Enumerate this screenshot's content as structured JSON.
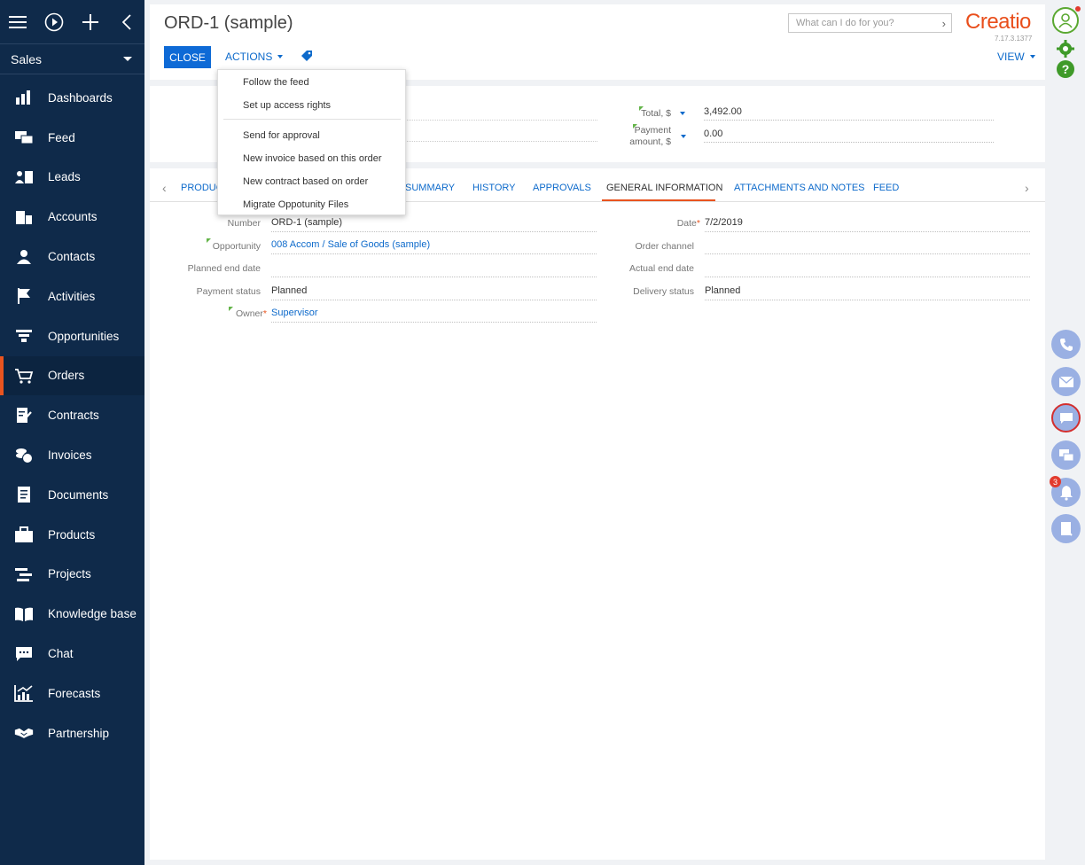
{
  "sidebar": {
    "workplace": "Sales",
    "items": [
      {
        "label": "Dashboards",
        "icon": "bar-chart-icon"
      },
      {
        "label": "Feed",
        "icon": "feed-icon"
      },
      {
        "label": "Leads",
        "icon": "leads-icon"
      },
      {
        "label": "Accounts",
        "icon": "accounts-icon"
      },
      {
        "label": "Contacts",
        "icon": "contact-icon"
      },
      {
        "label": "Activities",
        "icon": "flag-icon"
      },
      {
        "label": "Opportunities",
        "icon": "funnel-icon"
      },
      {
        "label": "Orders",
        "icon": "cart-icon"
      },
      {
        "label": "Contracts",
        "icon": "contract-icon"
      },
      {
        "label": "Invoices",
        "icon": "invoice-icon"
      },
      {
        "label": "Documents",
        "icon": "document-icon"
      },
      {
        "label": "Products",
        "icon": "products-icon"
      },
      {
        "label": "Projects",
        "icon": "projects-icon"
      },
      {
        "label": "Knowledge base",
        "icon": "book-icon"
      },
      {
        "label": "Chat",
        "icon": "chat-icon"
      },
      {
        "label": "Forecasts",
        "icon": "forecast-icon"
      },
      {
        "label": "Partnership",
        "icon": "handshake-icon"
      }
    ],
    "active": "Orders"
  },
  "header": {
    "title": "ORD-1 (sample)",
    "close_label": "CLOSE",
    "actions_label": "ACTIONS",
    "view_label": "VIEW",
    "search_placeholder": "What can I do for you?",
    "logo": "Creatio",
    "version": "7.17.3.1377"
  },
  "actions_menu": [
    "Follow the feed",
    "Set up access rights",
    "Send for approval",
    "New invoice based on this order",
    "New contract based on order",
    "Migrate Oppotunity Files"
  ],
  "summary": {
    "total_label": "Total, $",
    "total_value": "3,492.00",
    "payment_label_1": "Payment",
    "payment_label_2": "amount, $",
    "payment_value": "0.00"
  },
  "tabs": {
    "items": [
      "PRODUC",
      "SUMMARY",
      "HISTORY",
      "APPROVALS",
      "GENERAL INFORMATION",
      "ATTACHMENTS AND NOTES",
      "FEED"
    ],
    "active": "GENERAL INFORMATION"
  },
  "general": {
    "number_label": "Number",
    "number_value": "ORD-1 (sample)",
    "opportunity_label": "Opportunity",
    "opportunity_value": "008 Accom / Sale of Goods (sample)",
    "planned_end_label": "Planned end date",
    "planned_end_value": "",
    "payment_status_label": "Payment status",
    "payment_status_value": "Planned",
    "owner_label": "Owner",
    "owner_value": "Supervisor",
    "date_label": "Date",
    "date_value": "7/2/2019",
    "order_channel_label": "Order channel",
    "order_channel_value": "",
    "actual_end_label": "Actual end date",
    "actual_end_value": "",
    "delivery_status_label": "Delivery status",
    "delivery_status_value": "Planned"
  },
  "right_panel": {
    "notification_count": "3"
  },
  "colors": {
    "sidebar_bg": "#0f2a4a",
    "accent": "#e9541f",
    "link": "#0d6acb",
    "primary_button": "#0e6ad6"
  }
}
